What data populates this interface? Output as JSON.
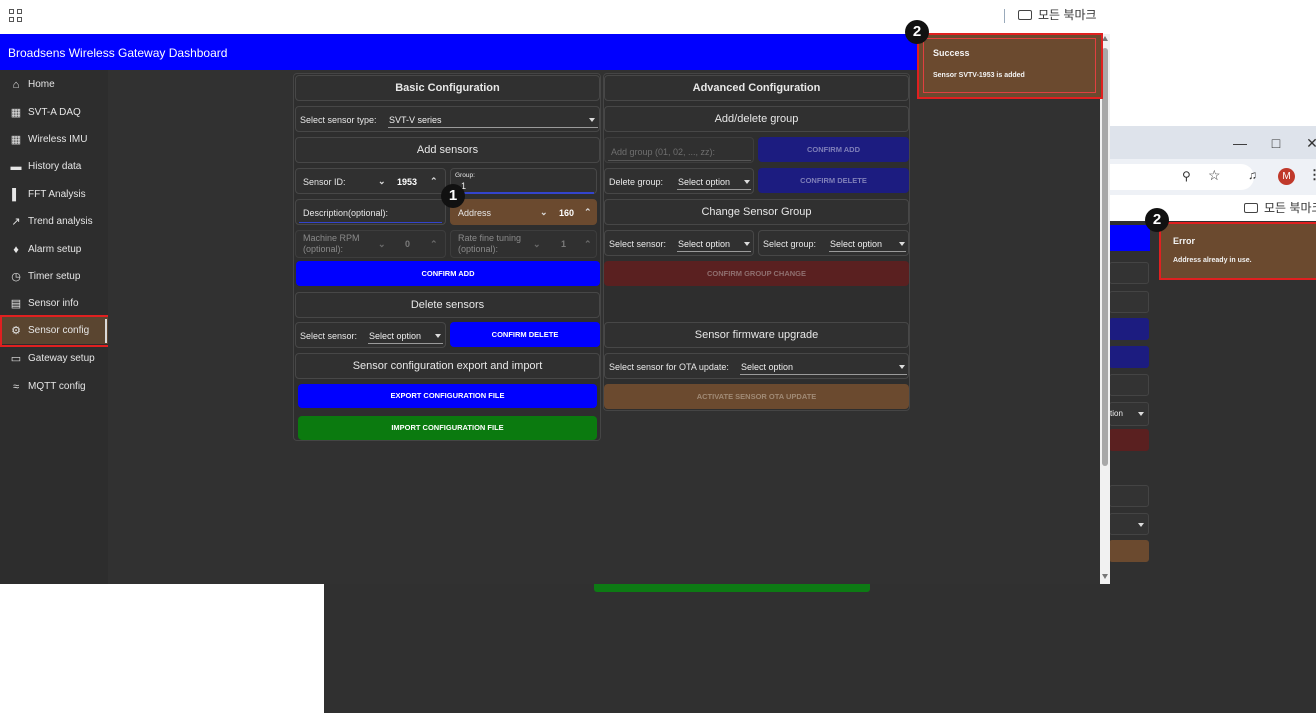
{
  "browser": {
    "bookmarks_label": "모든 북마크",
    "bookmarks_label_truncated": "모든 북마크"
  },
  "app": {
    "title": "Broadsens Wireless Gateway Dashboard"
  },
  "sidebar": {
    "items": [
      {
        "label": "Home",
        "icon": "home-icon"
      },
      {
        "label": "SVT-A DAQ",
        "icon": "dashboard-icon"
      },
      {
        "label": "Wireless IMU",
        "icon": "dashboard-icon"
      },
      {
        "label": "History data",
        "icon": "folder-icon"
      },
      {
        "label": "FFT Analysis",
        "icon": "bar-chart-icon"
      },
      {
        "label": "Trend analysis",
        "icon": "trend-icon"
      },
      {
        "label": "Alarm setup",
        "icon": "alarm-icon"
      },
      {
        "label": "Timer setup",
        "icon": "clock-icon"
      },
      {
        "label": "Sensor info",
        "icon": "info-card-icon"
      },
      {
        "label": "Sensor config",
        "icon": "gear-icon",
        "active": true
      },
      {
        "label": "Gateway setup",
        "icon": "laptop-icon"
      },
      {
        "label": "MQTT config",
        "icon": "wifi-icon"
      }
    ]
  },
  "basic": {
    "title": "Basic Configuration",
    "sensor_type_label": "Select sensor type:",
    "sensor_type_value": "SVT-V series",
    "add_sensors_title": "Add sensors",
    "sensor_id_label": "Sensor ID:",
    "sensor_id_value": "1953",
    "group_label": "Group:",
    "group_value": "1",
    "description_label": "Description(optional):",
    "address_label": "Address",
    "address_value": "160",
    "machine_rpm_label_1": "Machine RPM",
    "machine_rpm_label_2": "(optional):",
    "machine_rpm_value": "0",
    "rate_fine_label_1": "Rate fine tuning",
    "rate_fine_label_2": "(optional):",
    "rate_fine_value": "1",
    "confirm_add": "CONFIRM ADD",
    "delete_sensors_title": "Delete sensors",
    "select_sensor_label": "Select sensor:",
    "select_option": "Select option",
    "confirm_delete": "CONFIRM DELETE",
    "export_import_title": "Sensor configuration export and import",
    "export_button": "EXPORT CONFIGURATION FILE",
    "import_button": "IMPORT CONFIGURATION FILE"
  },
  "advanced": {
    "title": "Advanced Configuration",
    "add_delete_group_title": "Add/delete group",
    "add_group_placeholder": "Add group (01, 02, ..., zz):",
    "confirm_add": "CONFIRM ADD",
    "delete_group_label": "Delete group:",
    "select_option": "Select option",
    "confirm_delete": "CONFIRM DELETE",
    "change_group_title": "Change Sensor Group",
    "select_sensor_label": "Select sensor:",
    "select_group_label": "Select group:",
    "confirm_group_change": "CONFIRM GROUP CHANGE",
    "firmware_title": "Sensor firmware upgrade",
    "ota_label": "Select sensor for OTA update:",
    "activate_ota": "ACTIVATE SENSOR OTA UPDATE"
  },
  "toast_success": {
    "title": "Success",
    "message": "Sensor SVTV-1953 is added"
  },
  "toast_error": {
    "title": "Error",
    "message": "Address already in use."
  },
  "bg_window": {
    "select_fragment": "tion",
    "avatar_letter": "M"
  },
  "annotations": {
    "badge_1": "1",
    "badge_2": "2"
  },
  "colors": {
    "header_blue": "#0000ff",
    "toast_brown": "#6b4a2f",
    "highlight_red": "#e02020",
    "import_green": "#0b7a0f"
  }
}
